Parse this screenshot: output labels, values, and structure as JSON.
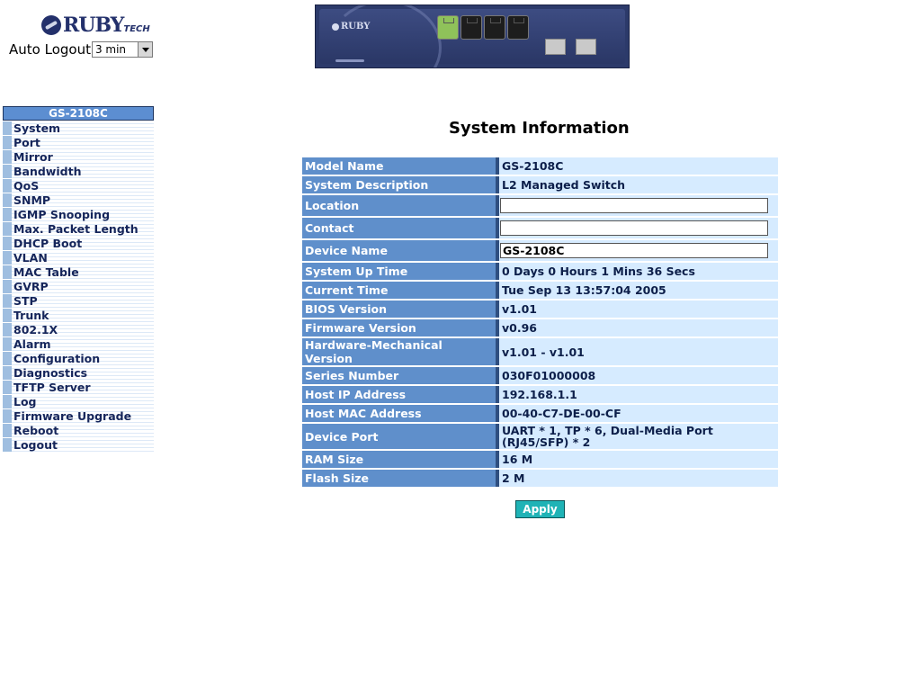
{
  "brand": {
    "logo_text": "RUBY",
    "logo_sub": "TECH"
  },
  "auto_logout": {
    "label": "Auto Logout",
    "value": "3 min"
  },
  "device_image": {
    "logo_text": "RUBY"
  },
  "sidebar": {
    "header": "GS-2108C",
    "items": [
      "System",
      "Port",
      "Mirror",
      "Bandwidth",
      "QoS",
      "SNMP",
      "IGMP Snooping",
      "Max. Packet Length",
      "DHCP Boot",
      "VLAN",
      "MAC Table",
      "GVRP",
      "STP",
      "Trunk",
      "802.1X",
      "Alarm",
      "Configuration",
      "Diagnostics",
      "TFTP Server",
      "Log",
      "Firmware Upgrade",
      "Reboot",
      "Logout"
    ]
  },
  "main": {
    "title": "System Information",
    "rows": {
      "model_name": {
        "label": "Model Name",
        "value": "GS-2108C"
      },
      "system_description": {
        "label": "System Description",
        "value": "L2 Managed Switch"
      },
      "location": {
        "label": "Location",
        "value": ""
      },
      "contact": {
        "label": "Contact",
        "value": ""
      },
      "device_name": {
        "label": "Device Name",
        "value": "GS-2108C"
      },
      "system_up_time": {
        "label": "System Up Time",
        "value": "0 Days 0 Hours 1 Mins 36 Secs"
      },
      "current_time": {
        "label": "Current Time",
        "value": "Tue Sep 13 13:57:04 2005"
      },
      "bios_version": {
        "label": "BIOS Version",
        "value": "v1.01"
      },
      "firmware_version": {
        "label": "Firmware Version",
        "value": "v0.96"
      },
      "hardware_mechanical_version": {
        "label": "Hardware-Mechanical Version",
        "value": "v1.01 - v1.01"
      },
      "series_number": {
        "label": "Series Number",
        "value": "030F01000008"
      },
      "host_ip_address": {
        "label": "Host IP Address",
        "value": "192.168.1.1"
      },
      "host_mac_address": {
        "label": "Host MAC Address",
        "value": "00-40-C7-DE-00-CF"
      },
      "device_port": {
        "label": "Device Port",
        "value": "UART * 1, TP * 6, Dual-Media Port (RJ45/SFP) * 2"
      },
      "ram_size": {
        "label": "RAM Size",
        "value": "16 M"
      },
      "flash_size": {
        "label": "Flash Size",
        "value": "2 M"
      }
    },
    "apply_label": "Apply"
  },
  "colors": {
    "label_bg": "#5f8fcb",
    "value_bg": "#d6ebff",
    "apply_bg": "#1fb3b6",
    "sidebar_head": "#5c8ed1"
  }
}
